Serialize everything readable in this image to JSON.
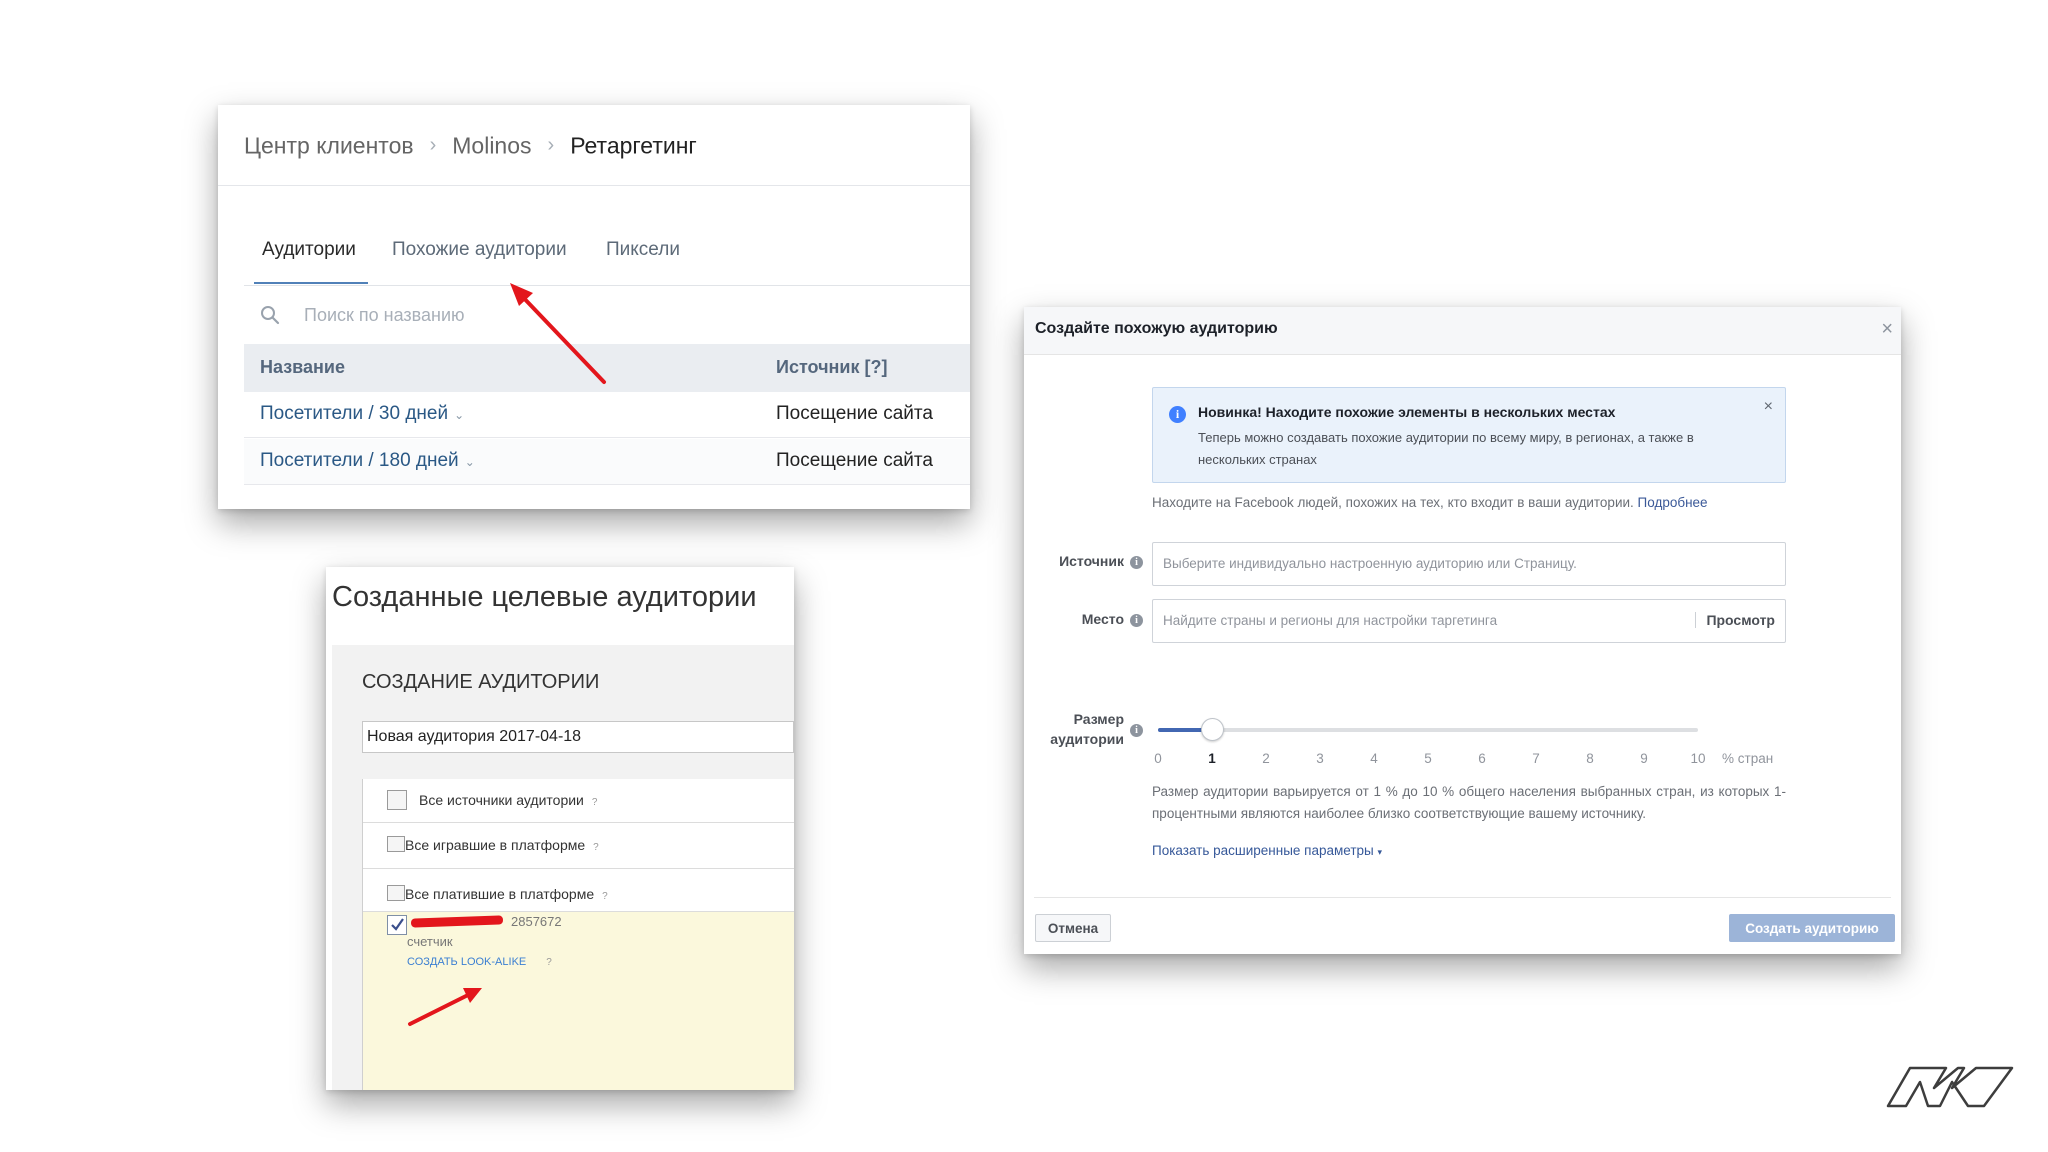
{
  "vk_panel": {
    "breadcrumbs": [
      "Центр клиентов",
      "Molinos",
      "Ретаргетинг"
    ],
    "tabs": [
      "Аудитории",
      "Похожие аудитории",
      "Пиксели"
    ],
    "active_tab": "Аудитории",
    "search_placeholder": "Поиск по названию",
    "columns": [
      "Название",
      "Источник [?]"
    ],
    "rows": [
      {
        "name": "Посетители / 30 дней",
        "source": "Посещение сайта"
      },
      {
        "name": "Посетители / 180 дней",
        "source": "Посещение сайта"
      }
    ]
  },
  "audience_panel": {
    "title": "Созданные целевые аудитории",
    "subtitle": "СОЗДАНИЕ АУДИТОРИИ",
    "name_value": "Новая аудитория 2017-04-18",
    "options": [
      {
        "label": "Все источники аудитории",
        "checked": false
      },
      {
        "label": "Все игравшие в платформе",
        "checked": false
      },
      {
        "label": "Все платившие в платформе",
        "checked": false
      }
    ],
    "selected": {
      "id": "2857672",
      "type": "счетчик",
      "action": "СОЗДАТЬ LOOK-ALIKE",
      "checked": true
    },
    "help_mark": "?"
  },
  "fb_dialog": {
    "title": "Создайте похожую аудиторию",
    "close": "×",
    "notice_title": "Новинка! Находите похожие элементы в нескольких местах",
    "notice_body": "Теперь можно создавать похожие аудитории по всему миру, в регионах, а также в нескольких странах",
    "description": "Находите на Facebook людей, похожих на тех, кто входит в ваши аудитории.",
    "description_link": "Подробнее",
    "source_label": "Источник",
    "source_placeholder": "Выберите индивидуально настроенную аудиторию или Страницу.",
    "place_label": "Место",
    "place_placeholder": "Найдите страны и регионы для настройки таргетинга",
    "browse": "Просмотр",
    "size_label_1": "Размер",
    "size_label_2": "аудитории",
    "slider_ticks": [
      "0",
      "1",
      "2",
      "3",
      "4",
      "5",
      "6",
      "7",
      "8",
      "9",
      "10"
    ],
    "slider_value": 1,
    "slider_unit": "% стран",
    "size_help": "Размер аудитории варьируется от 1 % до 10 % общего населения выбранных стран, из которых 1-процентными являются наиболее близко соответствующие вашему источнику.",
    "advanced": "Показать расширенные параметры",
    "cancel": "Отмена",
    "create": "Создать аудиторию"
  },
  "colors": {
    "vk_link": "#2a5885",
    "vk_accent": "#5181b8",
    "fb_blue": "#4267b2",
    "fb_button_disabled": "#9cb4d8",
    "annotation_red": "#e3161c"
  },
  "icons": [
    "search-icon",
    "chevron-right-icon",
    "chevron-down-icon",
    "info-icon",
    "close-icon",
    "checkmark-icon",
    "brand-logo-icon"
  ]
}
